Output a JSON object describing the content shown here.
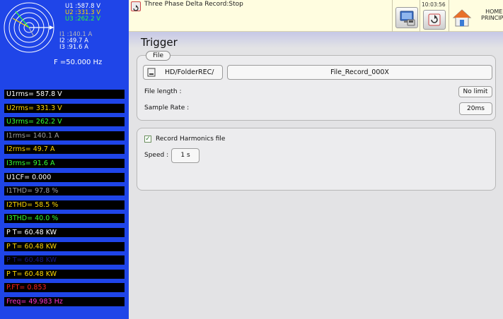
{
  "vector_display": {
    "u1": "U1 :587.8 V",
    "u2": "U2 :331.3 V",
    "u3": "U3 :262.2 V",
    "i1": "I1 :140.1 A",
    "i2": "I2 :49.7  A",
    "i3": "I3 :91.6  A",
    "frequency": "F  =50.000 Hz"
  },
  "measurements": [
    {
      "text": "U1rms= 587.8  V",
      "color": "#ffffff"
    },
    {
      "text": "U2rms= 331.3  V",
      "color": "#ffd700"
    },
    {
      "text": "U3rms= 262.2  V",
      "color": "#33ff33"
    },
    {
      "text": "I1rms= 140.1  A",
      "color": "#a0a0a0"
    },
    {
      "text": "I2rms= 49.7  A",
      "color": "#ffd700"
    },
    {
      "text": "I3rms= 91.6  A",
      "color": "#33ff33"
    },
    {
      "text": "U1CF= 0.000",
      "color": "#ffffff"
    },
    {
      "text": "I1THD= 97.8  %",
      "color": "#a0a0a0"
    },
    {
      "text": "I2THD= 58.5  %",
      "color": "#ffd700"
    },
    {
      "text": "I3THD= 40.0  %",
      "color": "#33ff33"
    },
    {
      "text": "P  T= 60.48  KW",
      "color": "#ffffff"
    },
    {
      "text": "P  T= 60.48  KW",
      "color": "#ffd700"
    },
    {
      "text": "P  T= 60.48  KW",
      "color": "#1a1a8a"
    },
    {
      "text": "P  T= 60.48  KW",
      "color": "#ffd700"
    },
    {
      "text": "P.FT= 0.853",
      "color": "#ff2020"
    },
    {
      "text": "Freq= 49.983  Hz",
      "color": "#ff33cc"
    }
  ],
  "topbar": {
    "status": "Three Phase Delta Record:Stop",
    "time": "10:03:56",
    "home_line1": "HOME",
    "home_line2": "PRINCIPA"
  },
  "page": {
    "title": "Trigger",
    "file_legend": "File",
    "folder_button": "HD/FolderREC/",
    "file_name": "File_Record_000X",
    "file_length_label": "File length :",
    "file_length_value": "No limit",
    "sample_rate_label": "Sample Rate :",
    "sample_rate_value": "20ms",
    "harmonics_label": "Record Harmonics file",
    "harmonics_checked": true,
    "speed_label": "Speed :",
    "speed_value": "1 s"
  },
  "colors": {
    "side_panel": "#1f45e8",
    "voltage_1": "#ffffff",
    "voltage_2": "#ffd700",
    "voltage_3": "#33ff33",
    "topbar_bg": "#fffde0"
  }
}
